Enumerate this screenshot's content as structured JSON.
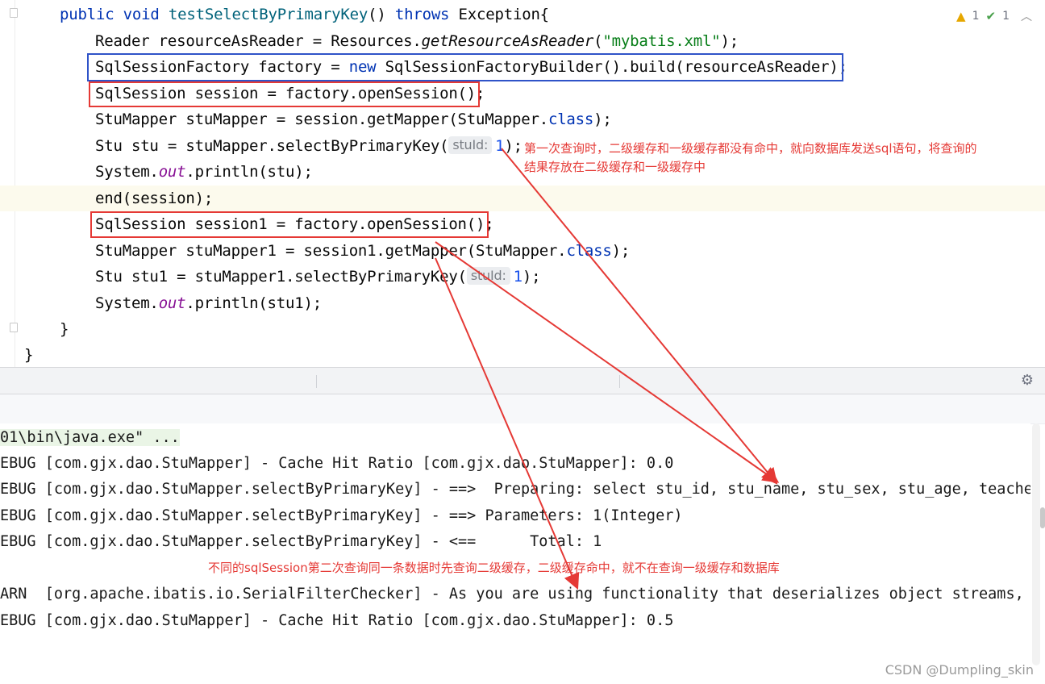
{
  "editor": {
    "inspections": {
      "warnings": "1",
      "ok": "1"
    },
    "lines": {
      "l1": {
        "a": "public void ",
        "b": "testSelectByPrimaryKey",
        "c": "() ",
        "d": "throws",
        "e": " Exception{"
      },
      "l2": {
        "a": "Reader resourceAsReader = Resources.",
        "b": "getResourceAsReader",
        "c": "(",
        "d": "\"mybatis.xml\"",
        "e": ");"
      },
      "l3": {
        "a": "SqlSessionFactory factory = ",
        "b": "new",
        "c": " SqlSessionFactoryBuilder().build(resourceAsReader);"
      },
      "l4": {
        "a": "SqlSession session = factory.openSession();"
      },
      "l5": {
        "a": "StuMapper stuMapper = session.getMapper(StuMapper.",
        "b": "class",
        "c": ");"
      },
      "l6": {
        "a": "Stu stu = stuMapper.selectByPrimaryKey(",
        "hint": "stuId:",
        "num": "1",
        "b": ");"
      },
      "l7": {
        "a": "System.",
        "b": "out",
        "c": ".println(stu);"
      },
      "l8": {
        "a": "end(session);"
      },
      "l9": {
        "a": "SqlSession session1 = factory.openSession();"
      },
      "l10": {
        "a": "StuMapper stuMapper1 = session1.getMapper(StuMapper.",
        "b": "class",
        "c": ");"
      },
      "l11": {
        "a": "Stu stu1 = stuMapper1.selectByPrimaryKey(",
        "hint": "stuId:",
        "num": "1",
        "b": ");"
      },
      "l12": {
        "a": "System.",
        "b": "out",
        "c": ".println(stu1);"
      },
      "l13": {
        "a": "}"
      },
      "l14": {
        "a": "}"
      }
    }
  },
  "annotations": {
    "first_query_1": "第一次查询时，二级缓存和一级缓存都没有命中，就向数据库发送sql语句，将查询的",
    "first_query_2": "结果存放在二级缓存和一级缓存中",
    "second_query": "不同的sqlSession第二次查询同一条数据时先查询二级缓存，二级缓存命中，就不在查询一级缓存和数据库"
  },
  "console": {
    "lines": [
      "01\\bin\\java.exe\" ...",
      "EBUG [com.gjx.dao.StuMapper] - Cache Hit Ratio [com.gjx.dao.StuMapper]: 0.0",
      "EBUG [com.gjx.dao.StuMapper.selectByPrimaryKey] - ==>  Preparing: select stu_id, stu_name, stu_sex, stu_age, teacher_i",
      "EBUG [com.gjx.dao.StuMapper.selectByPrimaryKey] - ==> Parameters: 1(Integer)",
      "EBUG [com.gjx.dao.StuMapper.selectByPrimaryKey] - <==      Total: 1",
      "ARN  [org.apache.ibatis.io.SerialFilterChecker] - As you are using functionality that deserializes object streams, it",
      "EBUG [com.gjx.dao.StuMapper] - Cache Hit Ratio [com.gjx.dao.StuMapper]: 0.5"
    ]
  },
  "watermark": "CSDN @Dumpling_skin",
  "colors": {
    "annotation_red": "#e53935",
    "box_blue": "#2f53c8"
  },
  "icons": {
    "warning": "warning-triangle-icon",
    "ok": "check-icon",
    "settings": "gear-icon"
  }
}
